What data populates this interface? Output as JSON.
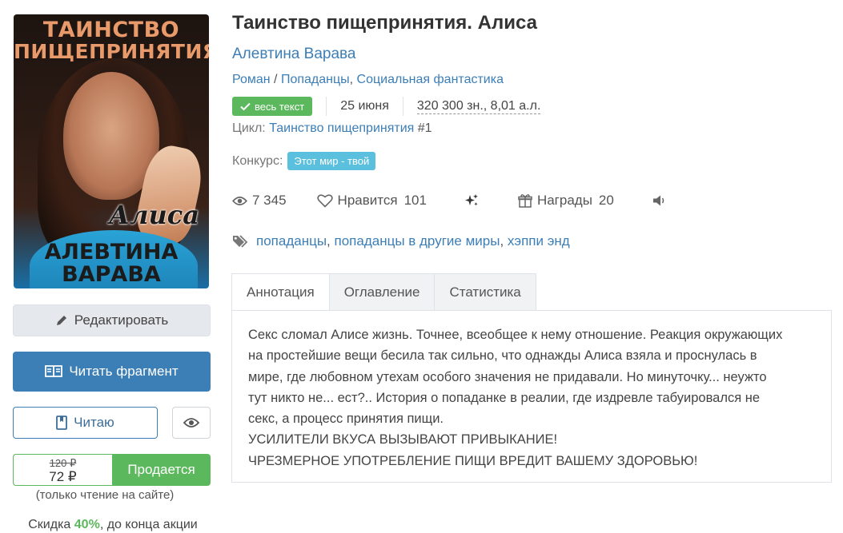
{
  "cover": {
    "title_line1": "ТАИНСТВО",
    "title_line2": "ПИЩЕПРИНЯТИЯ",
    "subtitle": "Алиса",
    "author_line1": "АЛЕВТИНА",
    "author_line2": "ВАРАВА"
  },
  "actions": {
    "edit_label": "Редактировать",
    "read_fragment_label": "Читать фрагмент",
    "reading_label": "Читаю"
  },
  "price": {
    "old": "120 ₽",
    "new": "72 ₽",
    "sale_label": "Продается",
    "note": "(только чтение на сайте)",
    "discount_prefix": "Скидка ",
    "discount_percent": "40%",
    "discount_suffix": ", до конца акции"
  },
  "book": {
    "title": "Таинство пищепринятия. Алиса",
    "author": "Алевтина Варава",
    "genres": [
      "Роман",
      "Попаданцы",
      "Социальная фантастика"
    ],
    "genre_sep1": " / ",
    "genre_sep2": ", ",
    "status_badge": "весь текст",
    "date": "25 июня",
    "size": "320 300 зн., 8,01 а.л.",
    "cycle_label": "Цикл: ",
    "cycle_name": "Таинство пищепринятия",
    "cycle_num": " #1",
    "contest_label": "Конкурс:",
    "contest_name": "Этот мир - твой"
  },
  "stats": {
    "views": "7 345",
    "likes_label": "Нравится",
    "likes": "101",
    "awards_label": "Награды",
    "awards": "20"
  },
  "tags": [
    "попаданцы",
    "попаданцы в другие миры",
    "хэппи энд"
  ],
  "tabs": [
    "Аннотация",
    "Оглавление",
    "Статистика"
  ],
  "annotation": {
    "line1": "Секс сломал Алисе жизнь. Точнее, всеобщее к нему отношение. Реакция окружающих",
    "line2": "на простейшие вещи бесила так сильно, что однажды Алиса взяла и проснулась в",
    "line3": "мире, где любовном утехам особого значения не придавали. Но минуточку... неужто",
    "line4": "тут никто не... ест?.. История о попаданке в реалии, где издревле табуировался не",
    "line5": "секс, а процесс принятия пищи.",
    "line6": "УСИЛИТЕЛИ ВКУСА ВЫЗЫВАЮТ ПРИВЫКАНИЕ!",
    "line7": "ЧРЕЗМЕРНОЕ УПОТРЕБЛЕНИЕ ПИЩИ ВРЕДИТ ВАШЕМУ ЗДОРОВЬЮ!"
  },
  "colors": {
    "link": "#3c7eb6",
    "success": "#5cb85c",
    "info": "#5bc0de",
    "primary_button": "#3c7eb6"
  }
}
